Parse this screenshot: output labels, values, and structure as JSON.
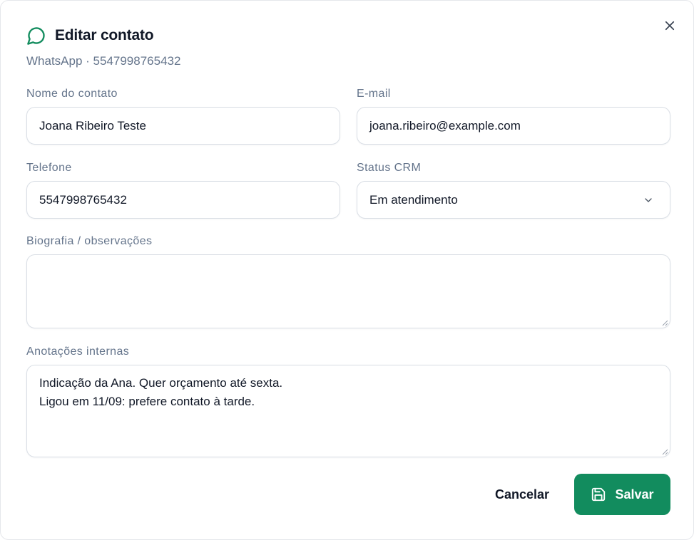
{
  "dialog": {
    "title": "Editar contato",
    "subtitle": "WhatsApp · 5547998765432",
    "close_icon": "close-icon",
    "title_icon": "chat-bubble-icon",
    "accent_color": "#128c5e"
  },
  "fields": {
    "name": {
      "label": "Nome do contato",
      "value": "Joana Ribeiro Teste"
    },
    "email": {
      "label": "E-mail",
      "value": "joana.ribeiro@example.com"
    },
    "phone": {
      "label": "Telefone",
      "value": "5547998765432"
    },
    "status": {
      "label": "Status CRM",
      "value": "Em atendimento",
      "icon": "chevron-down-icon"
    },
    "bio": {
      "label": "Biografia / observações",
      "value": ""
    },
    "notes": {
      "label": "Anotações internas",
      "lines": [
        "Indicação da Ana. Quer orçamento até sexta.",
        "Ligou em 11/09: prefere contato à tarde."
      ]
    }
  },
  "actions": {
    "cancel_label": "Cancelar",
    "save_label": "Salvar",
    "save_icon": "save-icon"
  }
}
